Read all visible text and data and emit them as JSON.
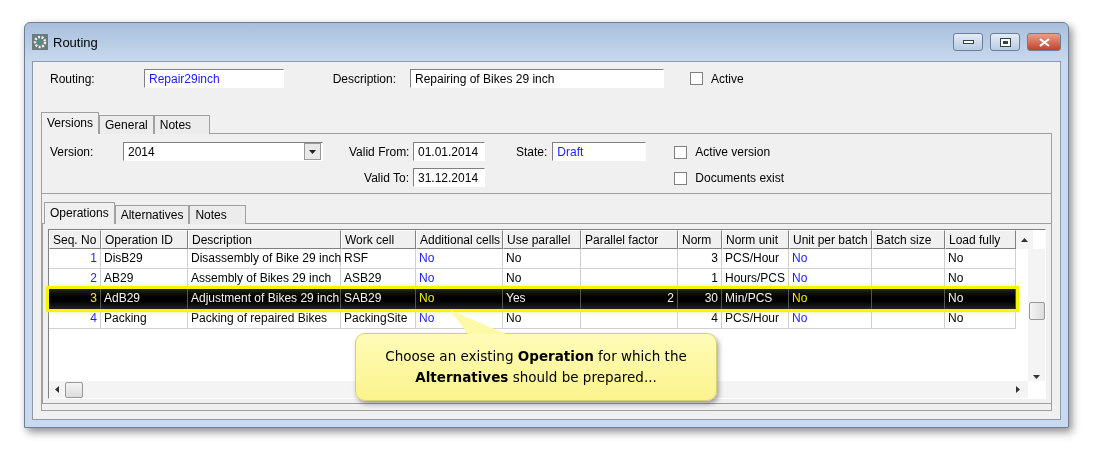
{
  "window": {
    "title": "Routing"
  },
  "header": {
    "routing_label": "Routing:",
    "routing": "Repair29inch",
    "description_label": "Description:",
    "description": "Repairing of Bikes 29 inch",
    "active": {
      "label": "Active",
      "checked": false
    }
  },
  "tabs": [
    {
      "label": "Versions",
      "selected": true
    },
    {
      "label": "General",
      "selected": false
    },
    {
      "label": "Notes",
      "selected": false
    }
  ],
  "version": {
    "label": "Version:",
    "value": "2014",
    "valid_from_label": "Valid From:",
    "valid_from": "01.01.2014",
    "valid_to_label": "Valid To:",
    "valid_to": "31.12.2014",
    "state_label": "State:",
    "state": "Draft",
    "checks": [
      {
        "label": "Active version",
        "checked": false
      },
      {
        "label": "Documents exist",
        "checked": false
      }
    ]
  },
  "inner_tabs": [
    {
      "label": "Operations",
      "selected": true
    },
    {
      "label": "Alternatives",
      "selected": false
    },
    {
      "label": "Notes",
      "selected": false
    }
  ],
  "table": {
    "columns": [
      {
        "label": "Seq. No",
        "kind": "seq"
      },
      {
        "label": "Operation ID",
        "kind": "text"
      },
      {
        "label": "Description",
        "kind": "text"
      },
      {
        "label": "Work cell",
        "kind": "text"
      },
      {
        "label": "Additional cells",
        "kind": "flag"
      },
      {
        "label": "Use parallel",
        "kind": "text"
      },
      {
        "label": "Parallel factor",
        "kind": "number"
      },
      {
        "label": "Norm",
        "kind": "number"
      },
      {
        "label": "Norm unit",
        "kind": "text"
      },
      {
        "label": "Unit per batch",
        "kind": "flag"
      },
      {
        "label": "Batch size",
        "kind": "text"
      },
      {
        "label": "Load fully",
        "kind": "text"
      }
    ],
    "rows": [
      {
        "selected": false,
        "cells": [
          "1",
          "DisB29",
          "Disassembly of Bike 29 inch",
          "RSF",
          "No",
          "No",
          "",
          "3",
          "PCS/Hour",
          "No",
          "",
          "No"
        ]
      },
      {
        "selected": false,
        "cells": [
          "2",
          "AB29",
          "Assembly of Bikes 29 inch",
          "ASB29",
          "No",
          "No",
          "",
          "1",
          "Hours/PCS",
          "No",
          "",
          "No"
        ]
      },
      {
        "selected": true,
        "cells": [
          "3",
          "AdB29",
          "Adjustment of Bikes 29 inch",
          "SAB29",
          "No",
          "Yes",
          "2",
          "30",
          "Min/PCS",
          "No",
          "",
          "No"
        ]
      },
      {
        "selected": false,
        "cells": [
          "4",
          "Packing",
          "Packing of repaired Bikes",
          "PackingSite",
          "No",
          "No",
          "",
          "4",
          "PCS/Hour",
          "No",
          "",
          "No"
        ]
      }
    ]
  },
  "callout": "Choose an existing **Operation** for which the **Alternatives** should be prepared..."
}
